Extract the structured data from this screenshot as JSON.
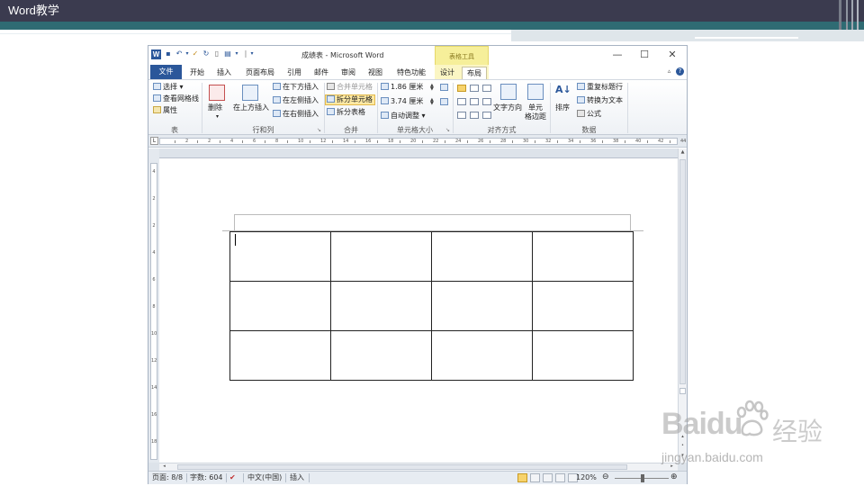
{
  "slide": {
    "title": "Word教学"
  },
  "window": {
    "doc_title": "成绩表 - Microsoft Word",
    "context_tab_group": "表格工具",
    "controls": {
      "minimize": "—",
      "maximize": "☐",
      "close": "✕"
    }
  },
  "tabs": {
    "file": "文件",
    "items": [
      "开始",
      "插入",
      "页面布局",
      "引用",
      "邮件",
      "审阅",
      "视图",
      "特色功能",
      "设计",
      "布局"
    ],
    "active": "布局"
  },
  "ribbon": {
    "table_group": {
      "select": "选择",
      "view_gridlines": "查看网格线",
      "properties": "属性",
      "label": "表"
    },
    "rows_cols_group": {
      "delete": "删除",
      "insert_above": "在上方插入",
      "insert_below": "在下方插入",
      "insert_left": "在左侧插入",
      "insert_right": "在右侧插入",
      "label": "行和列"
    },
    "merge_group": {
      "merge_cells": "合并单元格",
      "split_cells": "拆分单元格",
      "split_table": "拆分表格",
      "label": "合并"
    },
    "cell_size_group": {
      "height": "1.86 厘米",
      "width": "3.74 厘米",
      "autofit": "自动调整",
      "label": "单元格大小"
    },
    "alignment_group": {
      "text_direction": "文字方向",
      "cell_margins_line1": "单元",
      "cell_margins_line2": "格边距",
      "label": "对齐方式"
    },
    "data_group": {
      "sort": "排序",
      "repeat_header": "重复标题行",
      "convert_to_text": "转换为文本",
      "formula": "公式",
      "label": "数据"
    }
  },
  "ruler": {
    "h_numbers": [
      "2",
      "2",
      "4",
      "6",
      "8",
      "10",
      "12",
      "14",
      "16",
      "18",
      "20",
      "22",
      "24",
      "26",
      "28",
      "30",
      "32",
      "34",
      "36",
      "38",
      "40",
      "42",
      "44"
    ],
    "v_numbers": [
      "4",
      "2",
      "2",
      "4",
      "6",
      "8",
      "10",
      "12",
      "14",
      "16",
      "18"
    ]
  },
  "document": {
    "table": {
      "rows": 3,
      "cols": 4
    }
  },
  "status_bar": {
    "page": "页面: 8/8",
    "words": "字数: 604",
    "language": "中文(中国)",
    "mode": "插入",
    "zoom": "120%",
    "zoom_fraction": 0.52
  },
  "watermark": {
    "brand": "Baidu",
    "brand_zh": "经验",
    "url": "jingyan.baidu.com"
  },
  "colors": {
    "header_bg": "#3b3b4f",
    "teal_bar": "#2f6b73",
    "word_blue": "#2b579a",
    "context_yellow": "#f6ef9a"
  }
}
